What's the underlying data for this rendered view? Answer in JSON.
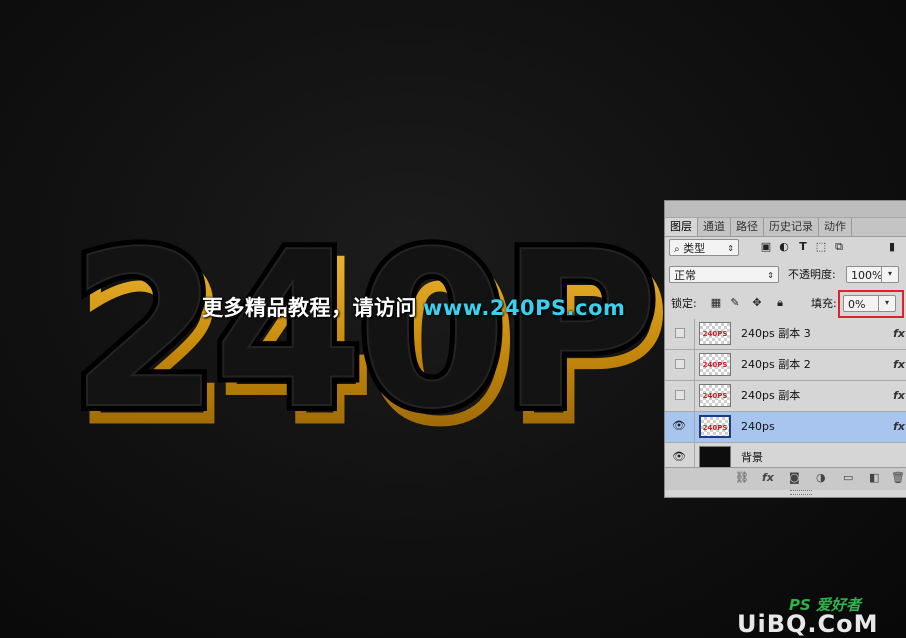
{
  "canvas": {
    "big_text": "240P",
    "watermark_cn": "更多精品教程，请访问",
    "watermark_url": "www.240PS.com",
    "accent_gold": "#e0a416",
    "watermark_url_color": "#3ad1ef"
  },
  "layers_panel": {
    "tabs": [
      "图层",
      "通道",
      "路径",
      "历史记录",
      "动作"
    ],
    "filter_kind": "类型",
    "filter_icons": [
      "image-filter-icon",
      "adjustment-filter-icon",
      "type-filter-icon",
      "shape-filter-icon",
      "smart-object-filter-icon"
    ],
    "blend_mode": "正常",
    "opacity_label": "不透明度:",
    "opacity_value": "100%",
    "lock_label": "锁定:",
    "fill_label": "填充:",
    "fill_value": "0%",
    "fill_highlight_color": "#e0202c",
    "layers": [
      {
        "name": "240ps 副本 3",
        "visible": false,
        "fx": "fx",
        "thumb": "240PS",
        "selected": false
      },
      {
        "name": "240ps 副本 2",
        "visible": false,
        "fx": "fx",
        "thumb": "240PS",
        "selected": false
      },
      {
        "name": "240ps 副本",
        "visible": false,
        "fx": "fx",
        "thumb": "240PS",
        "selected": false
      },
      {
        "name": "240ps",
        "visible": true,
        "fx": "fx",
        "thumb": "240PS",
        "selected": true
      },
      {
        "name": "背景",
        "visible": true,
        "fx": "",
        "thumb": "",
        "selected": false
      }
    ],
    "bottom_icons": [
      "link-icon",
      "fx-icon",
      "mask-icon",
      "adjustment-icon",
      "group-folder-icon",
      "new-layer-icon",
      "trash-icon"
    ],
    "fx_symbol": "fx"
  },
  "site_logo": {
    "top_text": "PS 爱好者",
    "main_text": "UiBQ.CoM"
  }
}
